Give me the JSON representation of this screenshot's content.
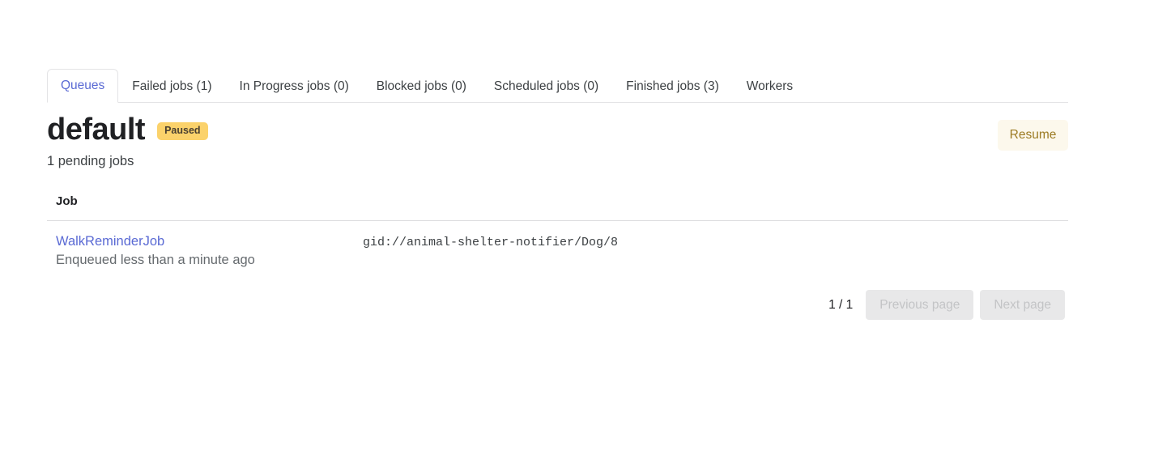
{
  "tabs": [
    {
      "label": "Queues",
      "active": true
    },
    {
      "label": "Failed jobs (1)",
      "active": false
    },
    {
      "label": "In Progress jobs (0)",
      "active": false
    },
    {
      "label": "Blocked jobs (0)",
      "active": false
    },
    {
      "label": "Scheduled jobs (0)",
      "active": false
    },
    {
      "label": "Finished jobs (3)",
      "active": false
    },
    {
      "label": "Workers",
      "active": false
    }
  ],
  "queue": {
    "name": "default",
    "status_badge": "Paused",
    "pending_summary": "1 pending jobs",
    "action_label": "Resume"
  },
  "table": {
    "columns": [
      "Job"
    ],
    "rows": [
      {
        "job_name": "WalkReminderJob",
        "job_meta": "Enqueued less than a minute ago",
        "gid": "gid://animal-shelter-notifier/Dog/8"
      }
    ]
  },
  "pagination": {
    "page_indicator": "1 / 1",
    "previous_label": "Previous page",
    "next_label": "Next page"
  },
  "colors": {
    "accent_link": "#5a6ad4",
    "badge_bg": "#fbd26b",
    "resume_bg": "#fcf8ec",
    "resume_text": "#9c7b23",
    "border": "#e4e4e6",
    "disabled_bg": "#e8e8e9",
    "disabled_text": "#c3c4c6"
  }
}
